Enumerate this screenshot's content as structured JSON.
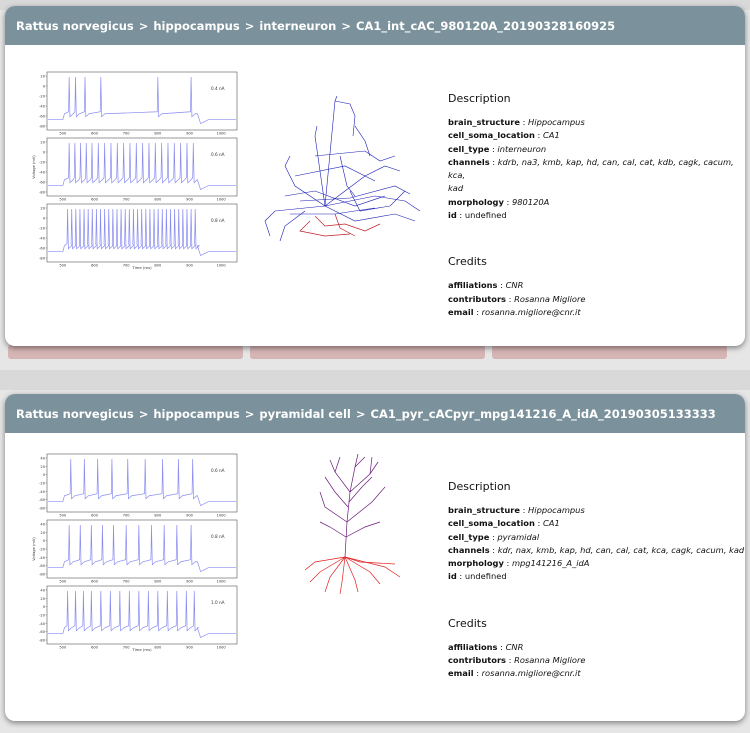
{
  "cards": [
    {
      "breadcrumb": [
        "Rattus norvegicus",
        "hippocampus",
        "interneuron",
        "CA1_int_cAC_980120A_20190328160925"
      ],
      "traces": {
        "currents": [
          "0.4 nA",
          "0.6 nA",
          "0.8 nA"
        ],
        "x_ticks": [
          "500",
          "600",
          "700",
          "800",
          "900",
          "1000"
        ],
        "y_ticks": [
          "20",
          "0",
          "-20",
          "-40",
          "-60",
          "-80"
        ],
        "xlabel": "Time (ms)",
        "ylabel": "Voltage (mV)",
        "spike_times": [
          [
            520,
            540,
            570,
            620,
            800,
            905
          ],
          [
            520,
            538,
            556,
            574,
            592,
            612,
            632,
            652,
            672,
            692,
            712,
            732,
            752,
            772,
            792,
            812,
            832,
            852,
            872,
            892,
            912
          ],
          [
            515,
            528,
            541,
            554,
            567,
            580,
            593,
            606,
            619,
            632,
            645,
            658,
            671,
            684,
            697,
            710,
            723,
            736,
            749,
            762,
            775,
            788,
            801,
            814,
            827,
            840,
            853,
            866,
            879,
            892,
            905,
            918
          ]
        ],
        "color": "#8a8cf0"
      },
      "morphology_colors": {
        "dendrite": "#1b1fb5",
        "axon": "#c0202a"
      },
      "description_title": "Description",
      "description": [
        {
          "key": "brain_structure",
          "value": "Hippocampus",
          "italic": true
        },
        {
          "key": "cell_soma_location",
          "value": "CA1",
          "italic": true
        },
        {
          "key": "cell_type",
          "value": "interneuron",
          "italic": true
        },
        {
          "key": "channels",
          "value": "kdrb, na3, kmb, kap, hd, can, cal, cat, kdb, cagk, cacum, kca,",
          "italic": true,
          "cont": "kad"
        },
        {
          "key": "morphology",
          "value": "980120A",
          "italic": true
        },
        {
          "key": "id",
          "value": "undefined",
          "italic": false
        }
      ],
      "credits_title": "Credits",
      "credits": [
        {
          "key": "affiliations",
          "value": "CNR"
        },
        {
          "key": "contributors",
          "value": "Rosanna Migliore"
        },
        {
          "key": "email",
          "value": "rosanna.migliore@cnr.it"
        }
      ]
    },
    {
      "breadcrumb": [
        "Rattus norvegicus",
        "hippocampus",
        "pyramidal cell",
        "CA1_pyr_cACpyr_mpg141216_A_idA_20190305133333"
      ],
      "traces": {
        "currents": [
          "0.6 nA",
          "0.8 nA",
          "1.0 nA"
        ],
        "x_ticks": [
          "500",
          "600",
          "700",
          "800",
          "900",
          "1000"
        ],
        "y_ticks": [
          "40",
          "20",
          "0",
          "-20",
          "-40",
          "-60",
          "-80"
        ],
        "xlabel": "Time (ms)",
        "ylabel": "Voltage (mV)",
        "spike_times": [
          [
            525,
            568,
            610,
            655,
            705,
            760,
            815,
            865,
            910
          ],
          [
            520,
            555,
            590,
            625,
            660,
            700,
            740,
            780,
            820,
            860,
            905
          ],
          [
            515,
            540,
            565,
            590,
            620,
            650,
            680,
            710,
            740,
            770,
            800,
            830,
            860,
            890,
            915
          ]
        ],
        "color": "#8a8cf0"
      },
      "morphology_colors": {
        "dendrite": "#6a1a7a",
        "axon": "#e02020"
      },
      "description_title": "Description",
      "description": [
        {
          "key": "brain_structure",
          "value": "Hippocampus",
          "italic": true
        },
        {
          "key": "cell_soma_location",
          "value": "CA1",
          "italic": true
        },
        {
          "key": "cell_type",
          "value": "pyramidal",
          "italic": true
        },
        {
          "key": "channels",
          "value": "kdr, nax, kmb, kap, hd, can, cal, cat, kca, cagk, cacum, kad",
          "italic": true
        },
        {
          "key": "morphology",
          "value": "mpg141216_A_idA",
          "italic": true
        },
        {
          "key": "id",
          "value": "undefined",
          "italic": false
        }
      ],
      "credits_title": "Credits",
      "credits": [
        {
          "key": "affiliations",
          "value": "CNR"
        },
        {
          "key": "contributors",
          "value": "Rosanna Migliore"
        },
        {
          "key": "email",
          "value": "rosanna.migliore@cnr.it"
        }
      ]
    }
  ]
}
